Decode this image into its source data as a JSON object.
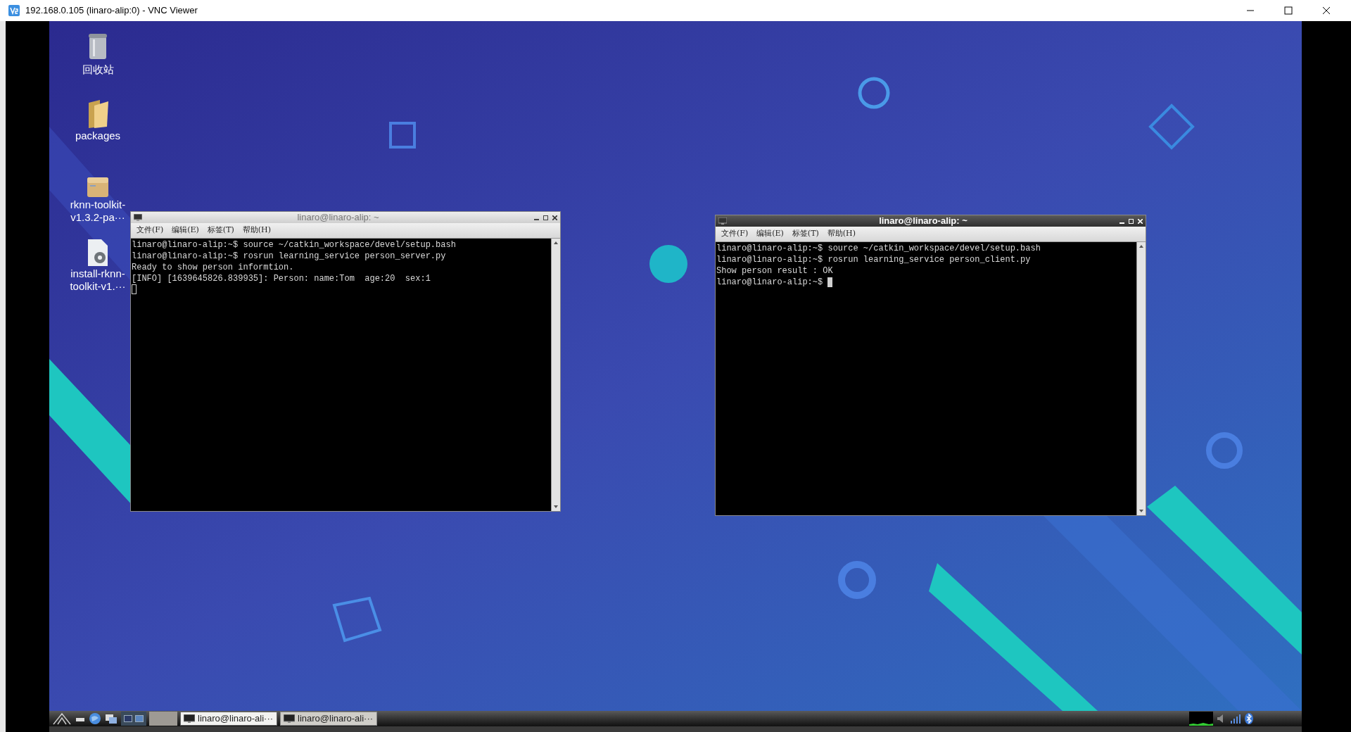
{
  "window": {
    "title": "192.168.0.105 (linaro-alip:0) - VNC Viewer"
  },
  "desktop_icons": [
    {
      "kind": "trash",
      "lines": [
        "回收站"
      ]
    },
    {
      "kind": "folder",
      "lines": [
        "packages"
      ]
    },
    {
      "kind": "package",
      "lines": [
        "rknn-toolkit-",
        "v1.3.2-pa···"
      ]
    },
    {
      "kind": "script",
      "lines": [
        "install-rknn-",
        "toolkit-v1.···"
      ]
    }
  ],
  "terminals": [
    {
      "title": "linaro@linaro-alip: ~",
      "focused": false,
      "menu": [
        "文件(F)",
        "编辑(E)",
        "标签(T)",
        "帮助(H)"
      ],
      "lines": [
        "linaro@linaro-alip:~$ source ~/catkin_workspace/devel/setup.bash",
        "linaro@linaro-alip:~$ rosrun learning_service person_server.py",
        "Ready to show person informtion.",
        "[INFO] [1639645826.839935]: Person: name:Tom  age:20  sex:1"
      ]
    },
    {
      "title": "linaro@linaro-alip: ~",
      "focused": true,
      "menu": [
        "文件(F)",
        "编辑(E)",
        "标签(T)",
        "帮助(H)"
      ],
      "lines": [
        "linaro@linaro-alip:~$ source ~/catkin_workspace/devel/setup.bash",
        "linaro@linaro-alip:~$ rosrun learning_service person_client.py",
        "Show person result : OK",
        "linaro@linaro-alip:~$ "
      ]
    }
  ],
  "taskbar": {
    "tasks": [
      {
        "label": "linaro@linaro-ali···",
        "selected": true
      },
      {
        "label": "linaro@linaro-ali···",
        "selected": false
      }
    ]
  }
}
